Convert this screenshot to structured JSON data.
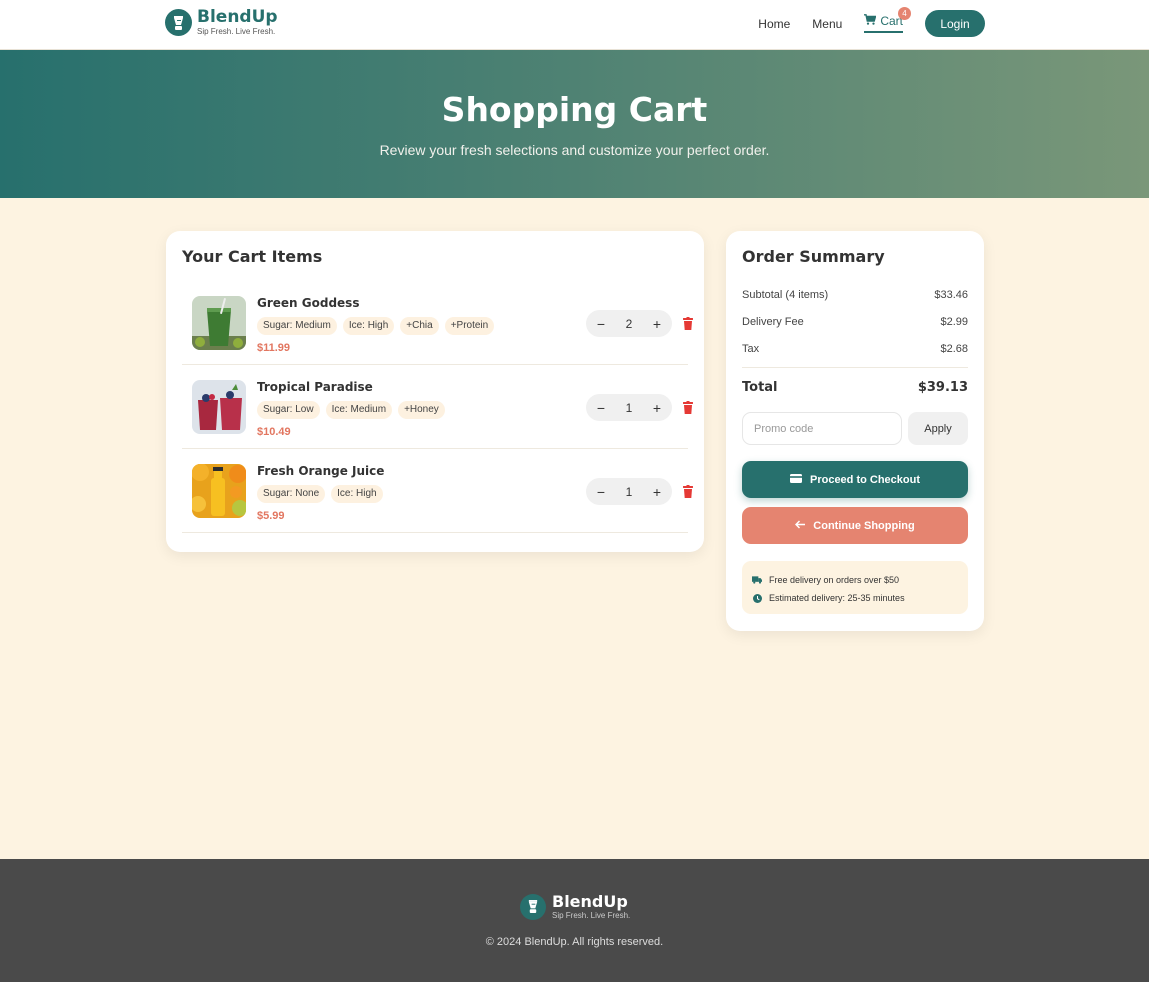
{
  "brand": {
    "name": "BlendUp",
    "tagline": "Sip Fresh. Live Fresh."
  },
  "nav": {
    "links": [
      "Home",
      "Menu"
    ],
    "cart_label": "Cart",
    "cart_count": "4",
    "login_label": "Login"
  },
  "hero": {
    "title": "Shopping Cart",
    "subtitle": "Review your fresh selections and customize your perfect order."
  },
  "cart": {
    "title": "Your Cart Items",
    "items": [
      {
        "name": "Green Goddess",
        "tags": [
          "Sugar: Medium",
          "Ice: High",
          "+Chia",
          "+Protein"
        ],
        "price": "$11.99",
        "qty": "2"
      },
      {
        "name": "Tropical Paradise",
        "tags": [
          "Sugar: Low",
          "Ice: Medium",
          "+Honey"
        ],
        "price": "$10.49",
        "qty": "1"
      },
      {
        "name": "Fresh Orange Juice",
        "tags": [
          "Sugar: None",
          "Ice: High"
        ],
        "price": "$5.99",
        "qty": "1"
      }
    ]
  },
  "summary": {
    "title": "Order Summary",
    "subtotal_label": "Subtotal (4 items)",
    "subtotal": "$33.46",
    "delivery_label": "Delivery Fee",
    "delivery": "$2.99",
    "tax_label": "Tax",
    "tax": "$2.68",
    "total_label": "Total",
    "total": "$39.13",
    "promo_placeholder": "Promo code",
    "apply_label": "Apply",
    "checkout_label": "Proceed to Checkout",
    "continue_label": "Continue Shopping",
    "info": [
      "Free delivery on orders over $50",
      "Estimated delivery: 25-35 minutes"
    ]
  },
  "footer": {
    "name": "BlendUp",
    "tagline": "Sip Fresh. Live Fresh.",
    "copyright": "© 2024 BlendUp. All rights reserved."
  },
  "colors": {
    "primary": "#27706d",
    "accent": "#e58470",
    "cream": "#fdf3e1",
    "footer": "#4a4a4a"
  }
}
